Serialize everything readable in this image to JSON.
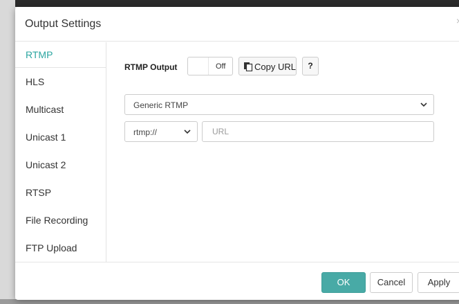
{
  "dialog": {
    "title": "Output Settings",
    "close_symbol": "×"
  },
  "sidebar": {
    "items": [
      {
        "label": "RTMP",
        "active": true
      },
      {
        "label": "HLS",
        "active": false
      },
      {
        "label": "Multicast",
        "active": false
      },
      {
        "label": "Unicast 1",
        "active": false
      },
      {
        "label": "Unicast 2",
        "active": false
      },
      {
        "label": "RTSP",
        "active": false
      },
      {
        "label": "File Recording",
        "active": false
      },
      {
        "label": "FTP Upload",
        "active": false
      }
    ]
  },
  "rtmp": {
    "output_label": "RTMP Output",
    "toggle_state": "Off",
    "copy_url_label": "Copy URL",
    "copy_icon": "copy-icon",
    "help_label": "?",
    "service_select": "Generic RTMP",
    "protocol_select": "rtmp://",
    "url_placeholder": "URL",
    "url_value": ""
  },
  "footer": {
    "ok_label": "OK",
    "cancel_label": "Cancel",
    "apply_label": "Apply"
  },
  "colors": {
    "accent": "#2aa5a0",
    "ok_button": "#48aaa6"
  }
}
